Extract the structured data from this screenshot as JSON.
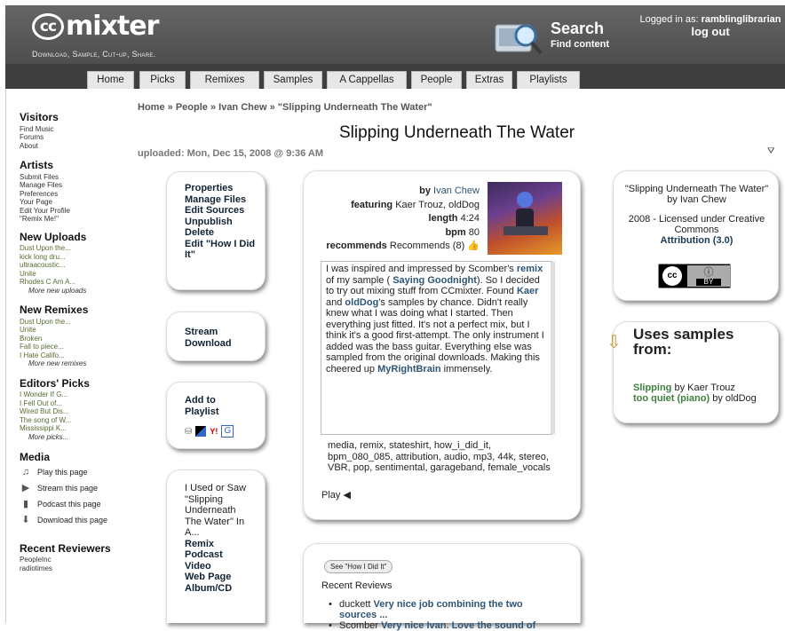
{
  "header": {
    "logo": "mixter",
    "logo_cc": "cc",
    "tagline": "Download, Sample, Cut-up, Share.",
    "search_title": "Search",
    "search_sub": "Find content",
    "logged_in_label": "Logged in as:",
    "username": "ramblinglibrarian",
    "logout": "log out"
  },
  "tabs": [
    "Home",
    "Picks",
    "Remixes",
    "Samples",
    "A Cappellas",
    "People",
    "Extras",
    "Playlists"
  ],
  "sidebar": {
    "visitors": {
      "title": "Visitors",
      "items": [
        "Find Music",
        "Forums",
        "About"
      ]
    },
    "artists": {
      "title": "Artists",
      "items": [
        "Submit Files",
        "Manage Files",
        "Preferences",
        "Your Page",
        "Edit Your Profile",
        "\"Remix Me!\""
      ]
    },
    "new_uploads": {
      "title": "New Uploads",
      "items": [
        "Dust Upon the...",
        "kick long dru...",
        "ultraacoustic...",
        "Unite",
        "Rhodes C Am A..."
      ],
      "more": "More new uploads"
    },
    "new_remixes": {
      "title": "New Remixes",
      "items": [
        "Dust Upon the...",
        "Unite",
        "Broken",
        "Fall to piece...",
        "I Hate Califo..."
      ],
      "more": "More new remixes"
    },
    "editors_picks": {
      "title": "Editors' Picks",
      "items": [
        "I Wonder If G...",
        "I Fell Out of...",
        "Wired But Dis...",
        "The song of W...",
        "Mississippi K..."
      ],
      "more": "More picks..."
    },
    "media": {
      "title": "Media",
      "items": [
        {
          "label": "Play this page",
          "icon": "music-note-icon"
        },
        {
          "label": "Stream this page",
          "icon": "play-icon"
        },
        {
          "label": "Podcast this page",
          "icon": "podcast-icon"
        },
        {
          "label": "Download this page",
          "icon": "download-icon"
        }
      ]
    },
    "reviewers": {
      "title": "Recent Reviewers",
      "items": [
        "PeopleInc",
        "radiotimes"
      ]
    }
  },
  "breadcrumb": {
    "home": "Home",
    "people": "People",
    "artist": "Ivan Chew",
    "current": "\"Slipping Underneath The Water\"",
    "sep": "»"
  },
  "page_title": "Slipping Underneath The Water",
  "uploaded": "uploaded: Mon, Dec 15, 2008 @ 9:36 AM",
  "menu1": [
    "Properties",
    "Manage Files",
    "Edit Sources",
    "Unpublish",
    "Delete",
    "Edit \"How I Did It\""
  ],
  "menu2": [
    "Stream",
    "Download"
  ],
  "menu3": {
    "add": "Add to Playlist"
  },
  "menu4": {
    "intro": "I Used or Saw \"Slipping Underneath The Water\" In A...",
    "items": [
      "Remix",
      "Podcast",
      "Video",
      "Web Page",
      "Album/CD"
    ]
  },
  "details": {
    "by_label": "by",
    "by": "Ivan Chew",
    "featuring_label": "featuring",
    "featuring": "Kaer Trouz, oldDog",
    "length_label": "length",
    "length": "4:24",
    "bpm_label": "bpm",
    "bpm": "80",
    "recommends_label": "recommends",
    "recommends": "Recommends (8)"
  },
  "description": {
    "p1": "I was inspired and impressed by Scomber's",
    "remix": "remix",
    "p2": "of my sample (",
    "saying": "Saying Goodnight",
    "p3": "). So I decided to try out mixing stuff from CCmixter. Found",
    "kaer": "Kaer",
    "and": "and",
    "olddog": "oldDog",
    "p4": "'s samples by chance. Didn't really knew what I was doing what I started. Then everything just fitted. It's not a perfect mix, but I think it's a good first-attempt. The only instrument I added was the bass guitar. Everything else was sampled from the original downloads. Making this cheered up",
    "myright": "MyRightBrain",
    "p5": "immensely."
  },
  "tags": "media, remix, stateshirt, how_i_did_it, bpm_080_085, attribution, audio, mp3, 44k, stereo, VBR, pop, sentimental, garageband, female_vocals",
  "play": "Play",
  "license": {
    "title": "\"Slipping Underneath The Water\"",
    "by": "by Ivan Chew",
    "line": "2008 - Licensed under Creative Commons",
    "type": "Attribution (3.0)",
    "badge_by": "BY"
  },
  "samples": {
    "title": "Uses samples from:",
    "s1_title": "Slipping",
    "s1_by": "by Kaer Trouz",
    "s2_title": "too quiet (piano)",
    "s2_by": "by oldDog"
  },
  "reviews": {
    "howto_btn": "See \"How I Did It\"",
    "title": "Recent Reviews",
    "r1_user": "duckett",
    "r1_text": "Very nice job combining the two sources ...",
    "r2_user": "Scomber",
    "r2_text": "Very nice Ivan. Love the sound of"
  },
  "colors": {
    "accent_link": "#2d5575",
    "green": "#3f7f3f",
    "header": "#555555"
  }
}
